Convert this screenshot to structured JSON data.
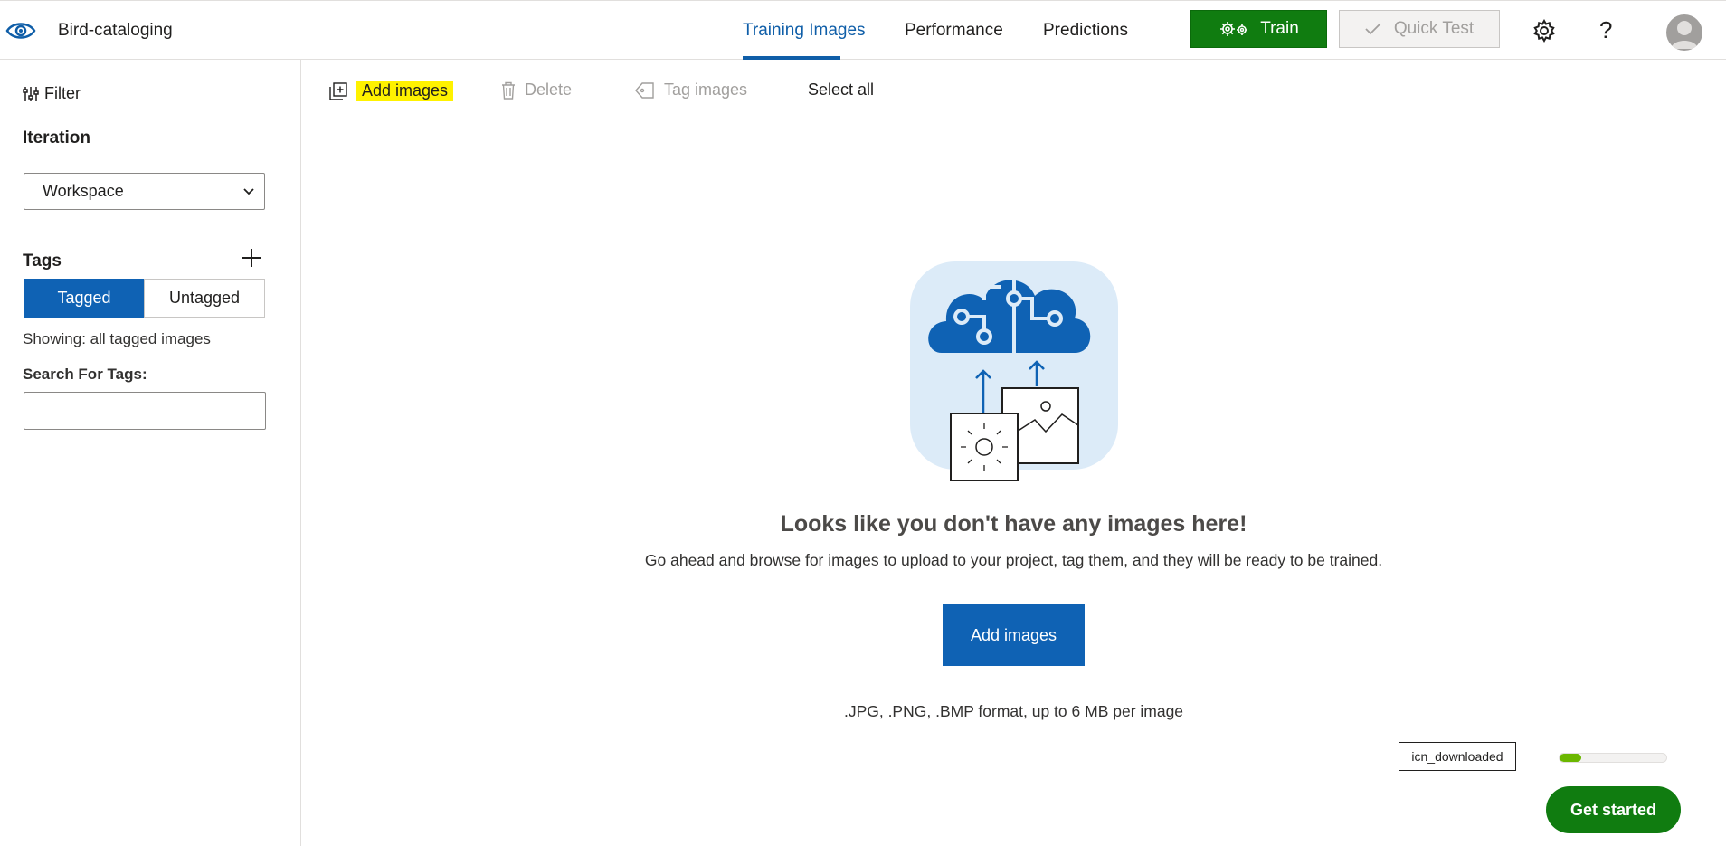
{
  "header": {
    "project_name": "Bird-cataloging",
    "tabs": [
      {
        "label": "Training Images",
        "active": true
      },
      {
        "label": "Performance",
        "active": false
      },
      {
        "label": "Predictions",
        "active": false
      }
    ],
    "train_label": "Train",
    "quick_test_label": "Quick Test",
    "help_label": "?"
  },
  "sidebar": {
    "filter_label": "Filter",
    "iteration_title": "Iteration",
    "iteration_value": "Workspace",
    "tags_title": "Tags",
    "tagged_label": "Tagged",
    "untagged_label": "Untagged",
    "showing_text": "Showing: all tagged images",
    "search_label": "Search For Tags:",
    "search_value": ""
  },
  "toolbar": {
    "add_images_label": "Add images",
    "delete_label": "Delete",
    "tag_images_label": "Tag images",
    "select_all_label": "Select all"
  },
  "empty_state": {
    "title": "Looks like you don't have any images here!",
    "subtitle": "Go ahead and browse for images to upload to your project, tag them, and they will be ready to be trained.",
    "button_label": "Add images",
    "formats_text": ".JPG, .PNG, .BMP format, up to 6 MB per image"
  },
  "widgets": {
    "icn_label": "icn_downloaded",
    "progress_fraction": 0.2,
    "get_started_label": "Get started"
  },
  "colors": {
    "accent": "#0f62b4",
    "train_green": "#107c10",
    "highlight": "#fff200"
  },
  "icons": [
    "eye-logo-icon",
    "filter-icon",
    "chevron-down-icon",
    "plus-icon",
    "gears-icon",
    "checkmark-icon",
    "gear-icon",
    "help-icon",
    "add-image-icon",
    "trash-icon",
    "tag-icon",
    "cloud-upload-illustration"
  ]
}
